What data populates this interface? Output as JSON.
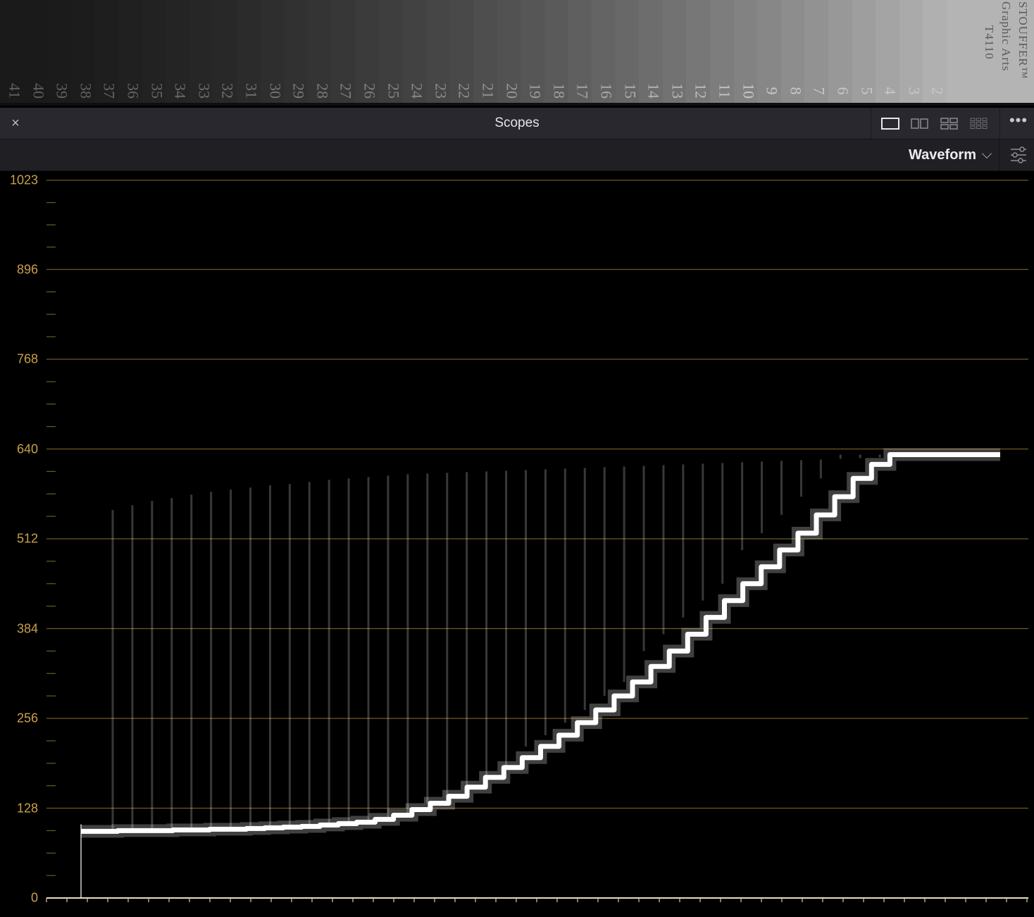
{
  "viewer": {
    "patch_numbers": [
      "41",
      "40",
      "39",
      "38",
      "37",
      "36",
      "35",
      "34",
      "33",
      "32",
      "31",
      "30",
      "29",
      "28",
      "27",
      "26",
      "25",
      "24",
      "23",
      "22",
      "21",
      "20",
      "19",
      "18",
      "17",
      "16",
      "15",
      "14",
      "13",
      "12",
      "11",
      "10",
      "9",
      "8",
      "7",
      "6",
      "5",
      "4",
      "3",
      "2"
    ],
    "brand_lines": [
      "STOUFFER™",
      "Graphic Arts",
      "T4110"
    ]
  },
  "panel": {
    "close_icon": "×",
    "title": "Scopes",
    "more_icon": "•••"
  },
  "toolbar": {
    "scope_type": "Waveform"
  },
  "colors": {
    "graticule": "#6e5a26",
    "label": "#c9a04a",
    "trace": "#ffffff"
  },
  "chart_data": {
    "type": "line",
    "title": "",
    "ylabel": "",
    "xlabel": "",
    "ylim": [
      0,
      1023
    ],
    "yticks": [
      0,
      128,
      256,
      384,
      512,
      640,
      768,
      896,
      1023
    ],
    "ytick_labels": [
      "0",
      "128",
      "256",
      "384",
      "512",
      "640",
      "768",
      "896",
      "1023"
    ],
    "grid": true,
    "series": [
      {
        "values": [
          95,
          95,
          96,
          96,
          96,
          97,
          97,
          98,
          98,
          99,
          100,
          101,
          102,
          104,
          106,
          108,
          112,
          118,
          126,
          135,
          145,
          158,
          172,
          186,
          200,
          216,
          232,
          250,
          268,
          288,
          308,
          330,
          352,
          376,
          400,
          424,
          448,
          472,
          496,
          520,
          546,
          572,
          598,
          618,
          632,
          632,
          632,
          632,
          632,
          632
        ]
      }
    ],
    "peak_values": [
      553,
      560,
      566,
      570,
      575,
      579,
      582,
      585,
      588,
      590,
      593,
      596,
      598,
      600,
      602,
      604,
      605,
      606,
      607,
      608,
      609,
      610,
      611,
      612,
      613,
      614,
      615,
      616,
      617,
      618,
      619,
      620,
      621,
      622,
      623,
      624,
      625,
      626,
      627,
      628,
      629,
      630
    ]
  }
}
